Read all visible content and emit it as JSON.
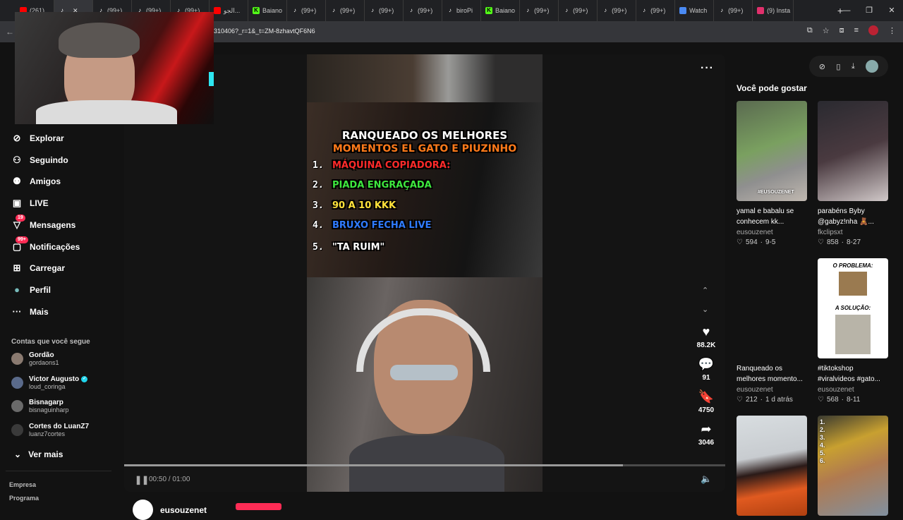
{
  "browser": {
    "tabs": [
      {
        "label": "(261)",
        "icon": "youtube-icon",
        "color": "#ff0000"
      },
      {
        "label": "",
        "icon": "tiktok-icon",
        "color": "#ffffff",
        "active": true
      },
      {
        "label": "(99+)",
        "icon": "tiktok-icon",
        "color": "#ffffff"
      },
      {
        "label": "(99+)",
        "icon": "tiktok-icon",
        "color": "#ffffff"
      },
      {
        "label": "(99+)",
        "icon": "tiktok-icon",
        "color": "#ffffff"
      },
      {
        "label": "الجو...",
        "icon": "youtube-icon",
        "color": "#ff0000"
      },
      {
        "label": "Baiano",
        "icon": "kick-icon",
        "color": "#53fc18"
      },
      {
        "label": "(99+)",
        "icon": "tiktok-icon",
        "color": "#ffffff"
      },
      {
        "label": "(99+)",
        "icon": "tiktok-icon",
        "color": "#ffffff"
      },
      {
        "label": "(99+)",
        "icon": "tiktok-icon",
        "color": "#ffffff"
      },
      {
        "label": "(99+)",
        "icon": "tiktok-icon",
        "color": "#ffffff"
      },
      {
        "label": "biroPi",
        "icon": "tiktok-icon",
        "color": "#ffffff"
      },
      {
        "label": "Baiano",
        "icon": "kick-icon",
        "color": "#53fc18"
      },
      {
        "label": "(99+)",
        "icon": "tiktok-icon",
        "color": "#ffffff"
      },
      {
        "label": "(99+)",
        "icon": "tiktok-icon",
        "color": "#ffffff"
      },
      {
        "label": "(99+)",
        "icon": "tiktok-icon",
        "color": "#ffffff"
      },
      {
        "label": "(99+)",
        "icon": "tiktok-icon",
        "color": "#ffffff"
      },
      {
        "label": "Watch",
        "icon": "watch-icon",
        "color": "#4a8af4"
      },
      {
        "label": "(99+)",
        "icon": "tiktok-icon",
        "color": "#ffffff"
      },
      {
        "label": "(9) Insta",
        "icon": "instagram-icon",
        "color": "#e1306c"
      }
    ],
    "url": "310406?_r=1&_t=ZM-8zhavtQF6N6"
  },
  "sidebar": {
    "nav": [
      {
        "label": "Explorar",
        "icon": "compass-icon"
      },
      {
        "label": "Seguindo",
        "icon": "user-follow-icon"
      },
      {
        "label": "Amigos",
        "icon": "friends-icon"
      },
      {
        "label": "LIVE",
        "icon": "live-icon"
      },
      {
        "label": "Mensagens",
        "icon": "messages-icon",
        "badge": "19"
      },
      {
        "label": "Notificações",
        "icon": "notifications-icon",
        "badge": "99+"
      },
      {
        "label": "Carregar",
        "icon": "upload-icon"
      },
      {
        "label": "Perfil",
        "icon": "profile-avatar"
      },
      {
        "label": "Mais",
        "icon": "more-icon"
      }
    ],
    "following_title": "Contas que você segue",
    "following": [
      {
        "name": "Gordão",
        "handle": "gordaons1",
        "verified": false
      },
      {
        "name": "Victor Augusto",
        "handle": "loud_coringa",
        "verified": true
      },
      {
        "name": "Bisnagarp",
        "handle": "bisnaguinharp",
        "verified": false
      },
      {
        "name": "Cortes do LuanZ7",
        "handle": "luanz7cortes",
        "verified": false
      }
    ],
    "see_more": "Ver mais",
    "footer": [
      "Empresa",
      "Programa"
    ]
  },
  "video": {
    "caption_title_1": "RANQUEADO OS MELHORES",
    "caption_title_2": "MOMENTOS EL GATO E PIUZINHO",
    "ranking": [
      {
        "num": "1.",
        "text": "MÁQUINA COPIADORA:",
        "color": "#ff2a2a"
      },
      {
        "num": "2.",
        "text": "PIADA ENGRAÇADA",
        "color": "#3ee83e"
      },
      {
        "num": "3.",
        "text": "90 A 10 KKK",
        "color": "#ffe23a"
      },
      {
        "num": "4.",
        "text": "BRUXO FECHA LIVE",
        "color": "#2f7bff"
      },
      {
        "num": "5.",
        "text": "\"TA RUIM\"",
        "color": "#ffffff"
      }
    ],
    "likes": "88.2K",
    "comments": "91",
    "saves": "4750",
    "shares": "3046",
    "time": "00:50 / 01:00",
    "progress": 0.83,
    "author": "eusouzenet"
  },
  "recommendations": {
    "title": "Você pode gostar",
    "items": [
      {
        "title": "yamal e babalu se conhecem kk...",
        "user": "eusouzenet",
        "likes": "594",
        "date": "9-5",
        "thumb_label": "#EUSOUZENET"
      },
      {
        "title": "parabéns Byby @gabyz!nha 🧸...",
        "user": "fkclipsxt",
        "likes": "858",
        "date": "8-27"
      },
      {
        "title": "Ranqueado os melhores momento...",
        "user": "eusouzenet",
        "likes": "212",
        "date": "1 d atrás"
      },
      {
        "title": "#tiktokshop #viralvideos #gato...",
        "user": "eusouzenet",
        "likes": "568",
        "date": "8-11",
        "thumb_top": "O PROBLEMA:",
        "thumb_mid": "A SOLUÇÃO:"
      },
      {
        "title": "",
        "user": "",
        "likes": "",
        "date": ""
      },
      {
        "title": "",
        "user": "",
        "likes": "",
        "date": "",
        "thumb_label": "1. 2. 3. 4. 5. 6."
      }
    ]
  }
}
